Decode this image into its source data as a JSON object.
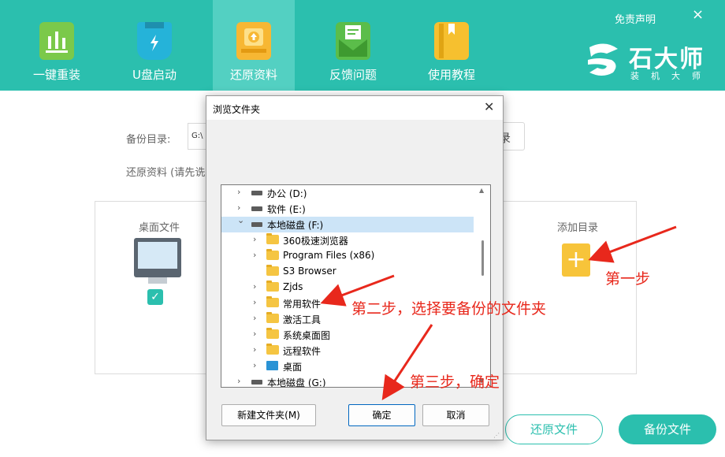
{
  "header": {
    "nav": [
      {
        "label": "一键重装",
        "icon": "bar-chart-icon",
        "active": false
      },
      {
        "label": "U盘启动",
        "icon": "usb-drive-icon",
        "active": false
      },
      {
        "label": "还原资料",
        "icon": "restore-icon",
        "active": true
      },
      {
        "label": "反馈问题",
        "icon": "feedback-mail-icon",
        "active": false
      },
      {
        "label": "使用教程",
        "icon": "tutorial-book-icon",
        "active": false
      }
    ],
    "disclaimer": "免责声明",
    "close": "×",
    "brand": "石大师",
    "brand_sub": "装机大师"
  },
  "main": {
    "backup_dir_label": "备份目录:",
    "backup_dir_value": "G:\\",
    "browse_partial": "录",
    "restore_hint": "还原资料 (请先诜",
    "desktop_files_label": "桌面文件",
    "desktop_checked": "✓",
    "add_dir_label": "添加目录",
    "add_icon": "+",
    "restore_button": "还原文件",
    "backup_button": "备份文件"
  },
  "dialog": {
    "title": "浏览文件夹",
    "close": "✕",
    "tree": [
      {
        "label": "办公 (D:)",
        "type": "drive",
        "chevron": "›",
        "level": 1
      },
      {
        "label": "软件 (E:)",
        "type": "drive",
        "chevron": "›",
        "level": 1
      },
      {
        "label": "本地磁盘 (F:)",
        "type": "drive",
        "chevron": "⌄",
        "level": 1,
        "selected": true
      },
      {
        "label": "360极速浏览器",
        "type": "folder",
        "chevron": "›",
        "level": 2
      },
      {
        "label": "Program Files (x86)",
        "type": "folder",
        "chevron": "›",
        "level": 2
      },
      {
        "label": "S3 Browser",
        "type": "folder",
        "chevron": "",
        "level": 2
      },
      {
        "label": "Zjds",
        "type": "folder",
        "chevron": "›",
        "level": 2
      },
      {
        "label": "常用软件",
        "type": "folder",
        "chevron": "›",
        "level": 2
      },
      {
        "label": "激活工具",
        "type": "folder",
        "chevron": "›",
        "level": 2
      },
      {
        "label": "系统桌面图",
        "type": "folder",
        "chevron": "›",
        "level": 2
      },
      {
        "label": "远程软件",
        "type": "folder",
        "chevron": "›",
        "level": 2
      },
      {
        "label": "桌面",
        "type": "desktop",
        "chevron": "›",
        "level": 2
      },
      {
        "label": "本地磁盘 (G:)",
        "type": "drive",
        "chevron": "›",
        "level": 1
      }
    ],
    "new_folder_button": "新建文件夹(M)",
    "ok_button": "确定",
    "cancel_button": "取消"
  },
  "annotations": {
    "step1": "第一步",
    "step2": "第二步，选择要备份的文件夹",
    "step3": "第三步，确定",
    "color": "#e8281c"
  },
  "colors": {
    "accent": "#2bbfae",
    "accent_active": "#53d0c2",
    "folder": "#f5c542"
  }
}
